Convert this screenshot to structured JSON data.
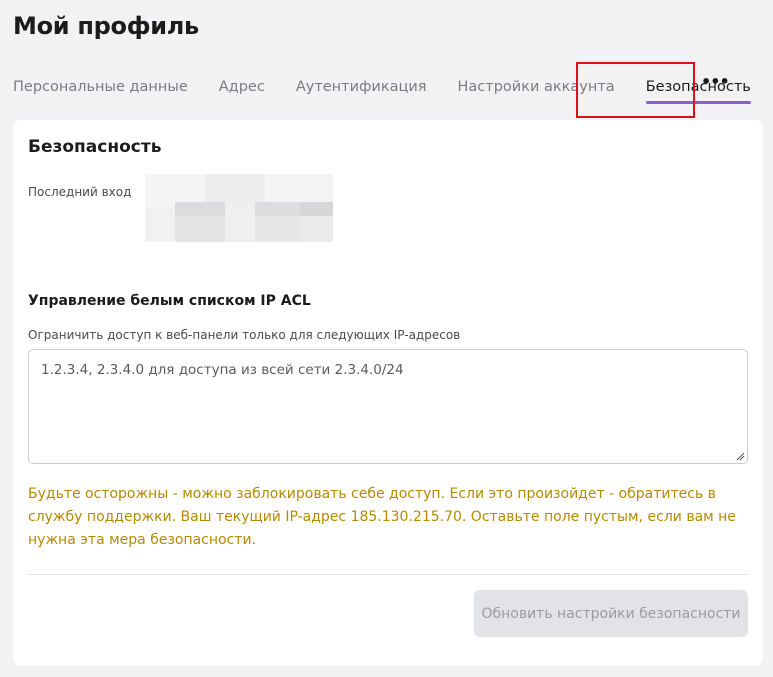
{
  "page": {
    "title": "Мой профиль"
  },
  "tabs": [
    {
      "label": "Персональные данные"
    },
    {
      "label": "Адрес"
    },
    {
      "label": "Аутентификация"
    },
    {
      "label": "Настройки аккаунта"
    },
    {
      "label": "Безопасность",
      "active": true
    }
  ],
  "more": {
    "label": "•••",
    "icon": "more-horizontal-icon"
  },
  "colors": {
    "accent": "#8a5cd6",
    "highlight_border": "#e0101a",
    "warning": "#b58a00",
    "button_disabled_bg": "#e2e3e6"
  },
  "security": {
    "title": "Безопасность",
    "last_login_label": "Последний вход",
    "acl": {
      "title": "Управление белым списком IP ACL",
      "description": "Ограничить доступ к веб-панели только для следующих IP-адресов",
      "placeholder": "1.2.3.4, 2.3.4.0 для доступа из всей сети 2.3.4.0/24",
      "value": ""
    },
    "warning": "Будьте осторожны - можно заблокировать себе доступ. Если это произойдет - обратитесь в службу поддержки. Ваш текущий IP-адрес 185.130.215.70. Оставьте поле пустым, если вам не нужна эта мера безопасности.",
    "submit_label": "Обновить настройки безопасности",
    "submit_disabled": true
  }
}
